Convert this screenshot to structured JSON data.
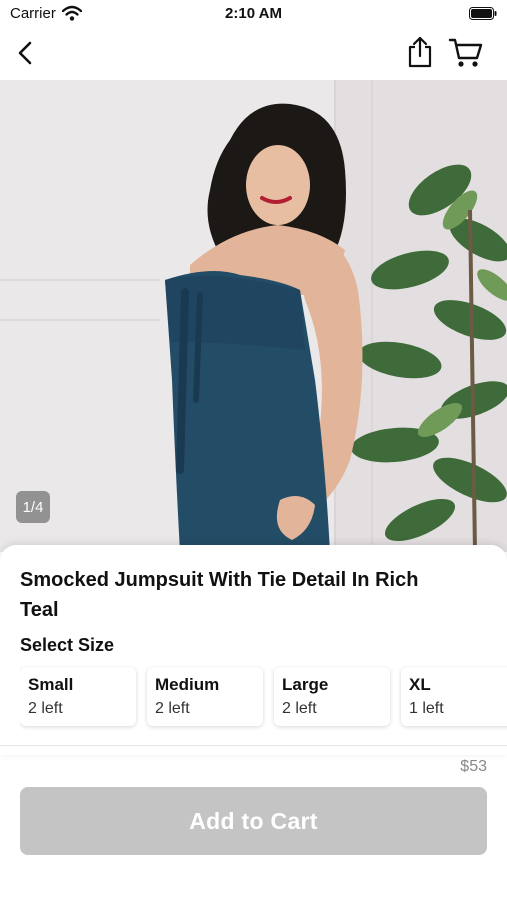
{
  "status_bar": {
    "carrier": "Carrier",
    "time": "2:10 AM"
  },
  "nav": {
    "back_icon": "chevron-left-icon",
    "share_icon": "share-icon",
    "cart_icon": "cart-icon"
  },
  "gallery": {
    "page_indicator": "1/4",
    "current_image": 1,
    "total_images": 4
  },
  "product": {
    "title": "Smocked Jumpsuit With Tie Detail In Rich Teal",
    "size_heading": "Select Size",
    "sizes": [
      {
        "label": "Small",
        "stock": "2 left"
      },
      {
        "label": "Medium",
        "stock": "2 left"
      },
      {
        "label": "Large",
        "stock": "2 left"
      },
      {
        "label": "XL",
        "stock": "1 left"
      }
    ],
    "price": "$53",
    "add_to_cart_label": "Add to Cart"
  },
  "colors": {
    "button_disabled": "#c4c4c4",
    "dress_teal": "#234d66",
    "background": "#ebe8e9"
  }
}
